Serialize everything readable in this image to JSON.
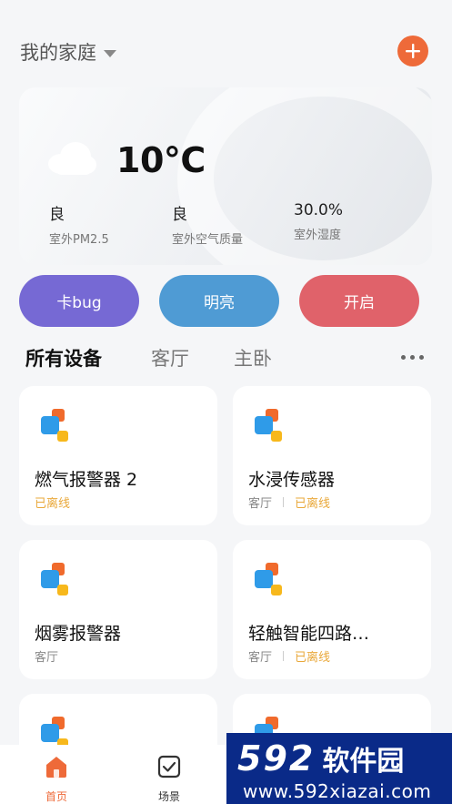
{
  "header": {
    "title": "我的家庭"
  },
  "weather": {
    "temperature": "10°C",
    "metrics": [
      {
        "value": "良",
        "label": "室外PM2.5"
      },
      {
        "value": "良",
        "label": "室外空气质量"
      },
      {
        "value": "30.0%",
        "label": "室外湿度"
      }
    ]
  },
  "scenes": [
    {
      "label": "卡bug",
      "color": "#7669d4"
    },
    {
      "label": "明亮",
      "color": "#4f9bd4"
    },
    {
      "label": "开启",
      "color": "#e0626a"
    }
  ],
  "tabs": [
    "所有设备",
    "客厅",
    "主卧"
  ],
  "devices": [
    {
      "name": "燃气报警器 2",
      "room": "",
      "status": "已离线"
    },
    {
      "name": "水浸传感器",
      "room": "客厅",
      "status": "已离线"
    },
    {
      "name": "烟雾报警器",
      "room": "客厅",
      "status": ""
    },
    {
      "name": "轻触智能四路…",
      "room": "客厅",
      "status": "已离线"
    }
  ],
  "tabbar": {
    "items": [
      {
        "label": "首页",
        "icon": "home-icon",
        "active": true
      },
      {
        "label": "场景",
        "icon": "scene-checkbox-icon",
        "active": false
      }
    ]
  },
  "watermark": {
    "brand_num": "592",
    "brand_cn": "软件园",
    "url": "www.592xiazai.com"
  },
  "colors": {
    "accent": "#ee6a39",
    "offline": "#e9a83a",
    "icon_orange": "#f06a2c",
    "icon_blue": "#2f9be8",
    "icon_yellow": "#f7b81c"
  }
}
